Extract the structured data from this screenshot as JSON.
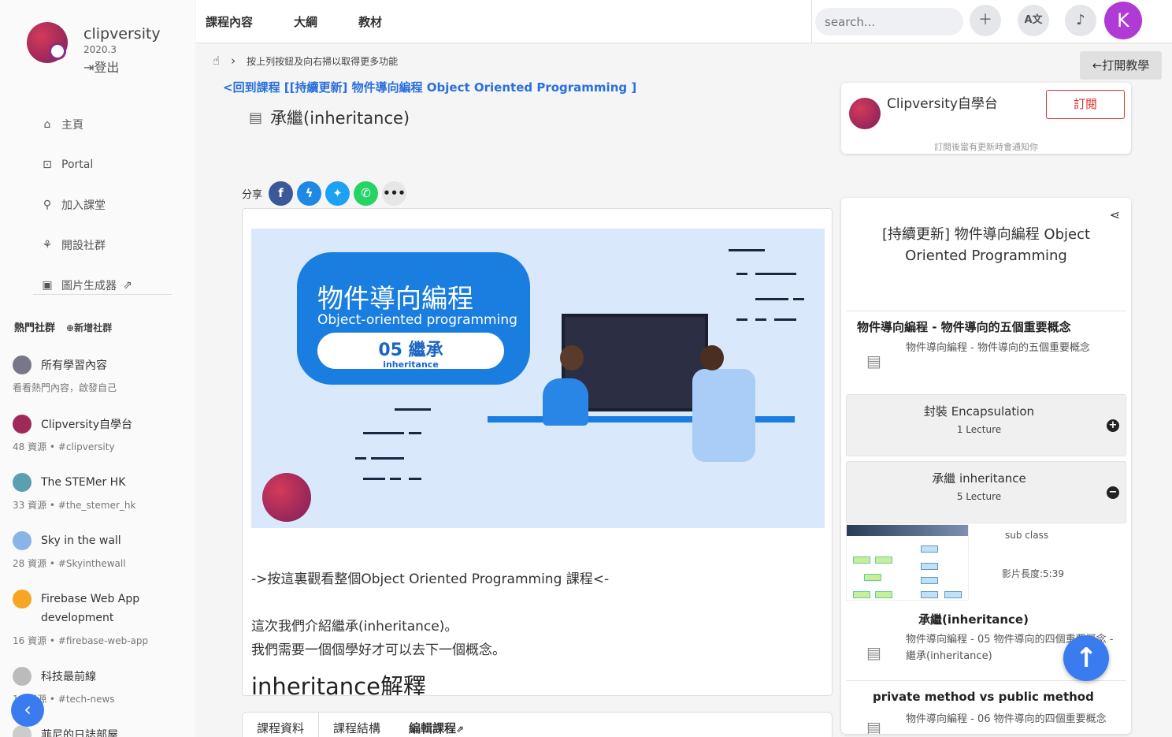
{
  "brand": {
    "name": "clipversity",
    "version": "2020.3",
    "logout": "登出"
  },
  "nav": [
    {
      "label": "主頁",
      "icon": "home-icon"
    },
    {
      "label": "Portal",
      "icon": "portal-icon"
    },
    {
      "label": "加入課堂",
      "icon": "join-icon"
    },
    {
      "label": "開設社群",
      "icon": "create-community-icon"
    },
    {
      "label": "圖片生成器",
      "icon": "image-generator-icon"
    }
  ],
  "hot": {
    "title": "熱門社群",
    "add": "新增社群"
  },
  "communities": [
    {
      "name": "所有學習內容",
      "meta": "看看熱門內容，啟發自己"
    },
    {
      "name": "Clipversity自學台",
      "meta": "48 資源 • #clipversity"
    },
    {
      "name": "The STEMer HK",
      "meta": "33 資源 • #the_stemer_hk"
    },
    {
      "name": "Sky in the wall",
      "meta": "28 資源 • #Skyinthewall"
    },
    {
      "name": "Firebase Web App development",
      "meta": "16 資源 • #firebase-web-app"
    },
    {
      "name": "科技最前線",
      "meta": "16 資源 • #tech-news"
    },
    {
      "name": "菲尼的日誌部屋",
      "meta": ""
    }
  ],
  "topbar": {
    "tabs": [
      "課程內容",
      "大綱",
      "教材"
    ],
    "search_placeholder": "search...",
    "avatar_letter": "K"
  },
  "hint": "按上列按鈕及向右掃以取得更多功能",
  "back_link": "<回到課程 [[持續更新] 物件導向編程 Object Oriented Programming ]",
  "lesson_title": "承繼(inheritance)",
  "open_tutorial": "打開教學",
  "share_label": "分享",
  "banner": {
    "title": "物件導向編程",
    "subtitle": "Object-oriented programming",
    "number": "05 繼承",
    "number_en": "inheritance"
  },
  "content": {
    "link_text": "->按這裏觀看整個Object Oriented Programming 課程<-",
    "para1": "這次我們介紹繼承(inheritance)。",
    "para2": "我們需要一個個學好才可以去下一個概念。",
    "heading": "inheritance解釋"
  },
  "bottom_tabs": [
    "課程資料",
    "課程結構",
    "編輯課程"
  ],
  "subscribe": {
    "name": "Clipversity自學台",
    "button": "訂閱",
    "note": "訂閱後當有更新時會通知你"
  },
  "course": {
    "title": "[持續更新] 物件導向編程 Object Oriented Programming",
    "intro_section": "物件導向編程 - 物件導向的五個重要概念",
    "intro_lecture": "物件導向編程 - 物件導向的五個重要概念",
    "modules": [
      {
        "name": "封裝 Encapsulation",
        "count": "1 Lecture",
        "toggle": "+"
      },
      {
        "name": "承繼 inheritance",
        "count": "5 Lecture",
        "toggle": "−"
      }
    ],
    "video": {
      "label": "sub class",
      "duration": "影片長度:5:39"
    },
    "inherit_title": "承繼(inheritance)",
    "inherit_desc": "物件導向編程 - 05 物件導向的四個重要概念 - 繼承(inheritance)",
    "private_title": "private method vs public method",
    "private_desc": "物件導向編程 - 06 物件導向的四個重要概念"
  },
  "colors": {
    "accent": "#2a6fdb",
    "facebook": "#3b5998",
    "messenger": "#1e88e5",
    "twitter": "#1da1f2",
    "whatsapp": "#25d366",
    "subscribe": "#dd3333",
    "avatar": "#b03ad6"
  }
}
